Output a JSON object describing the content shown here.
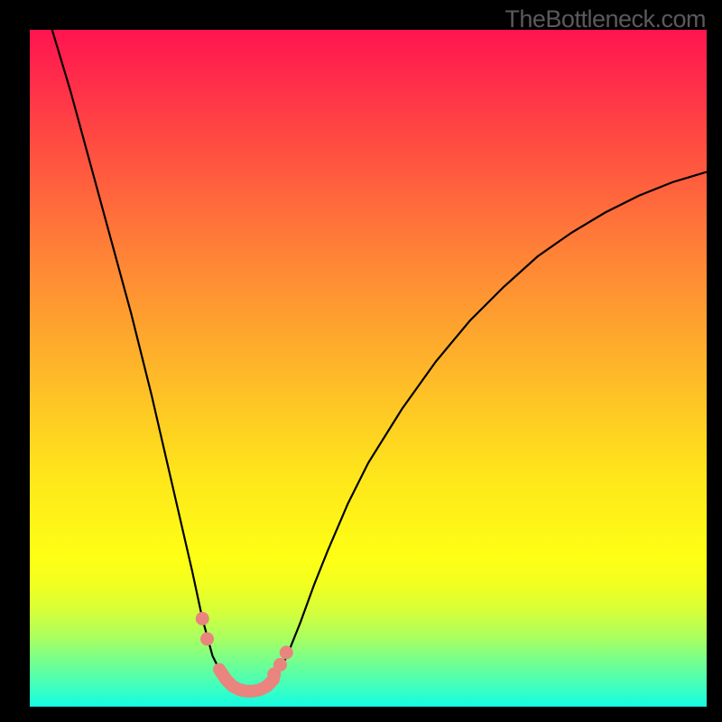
{
  "watermark": "TheBottleneck.com",
  "colors": {
    "frame_bg": "#000000",
    "gradient_top": "#ff1450",
    "gradient_bottom": "#14fae3",
    "line": "#000000",
    "markers": "#e9847e"
  },
  "chart_data": {
    "type": "line",
    "title": "",
    "xlabel": "",
    "ylabel": "",
    "xlim": [
      0,
      100
    ],
    "ylim": [
      0,
      100
    ],
    "x": [
      3.3,
      6,
      9,
      12,
      15,
      18,
      21,
      24,
      25.5,
      27,
      28,
      29,
      30,
      31,
      32,
      33,
      34,
      35,
      36,
      37,
      38,
      40,
      42,
      44,
      47,
      50,
      55,
      60,
      65,
      70,
      75,
      80,
      85,
      90,
      95,
      100
    ],
    "values": [
      100,
      91,
      80,
      69,
      58,
      46,
      33,
      20,
      13,
      7.5,
      5.5,
      4,
      3,
      2.5,
      2.3,
      2.3,
      2.5,
      3,
      4,
      5.5,
      7.5,
      12.5,
      18,
      23,
      30,
      36,
      44,
      51,
      57,
      62,
      66.5,
      70,
      73,
      75.5,
      77.5,
      79
    ],
    "markers": {
      "dots": [
        {
          "x": 25.5,
          "y": 13
        },
        {
          "x": 26.2,
          "y": 10
        },
        {
          "x": 36.1,
          "y": 4.8
        },
        {
          "x": 37,
          "y": 6.2
        },
        {
          "x": 37.9,
          "y": 8
        }
      ],
      "segment": {
        "x": [
          28,
          29,
          30,
          31,
          32,
          33,
          34,
          35,
          36
        ],
        "y": [
          5.5,
          4,
          3,
          2.5,
          2.3,
          2.3,
          2.5,
          3,
          4
        ]
      }
    }
  }
}
